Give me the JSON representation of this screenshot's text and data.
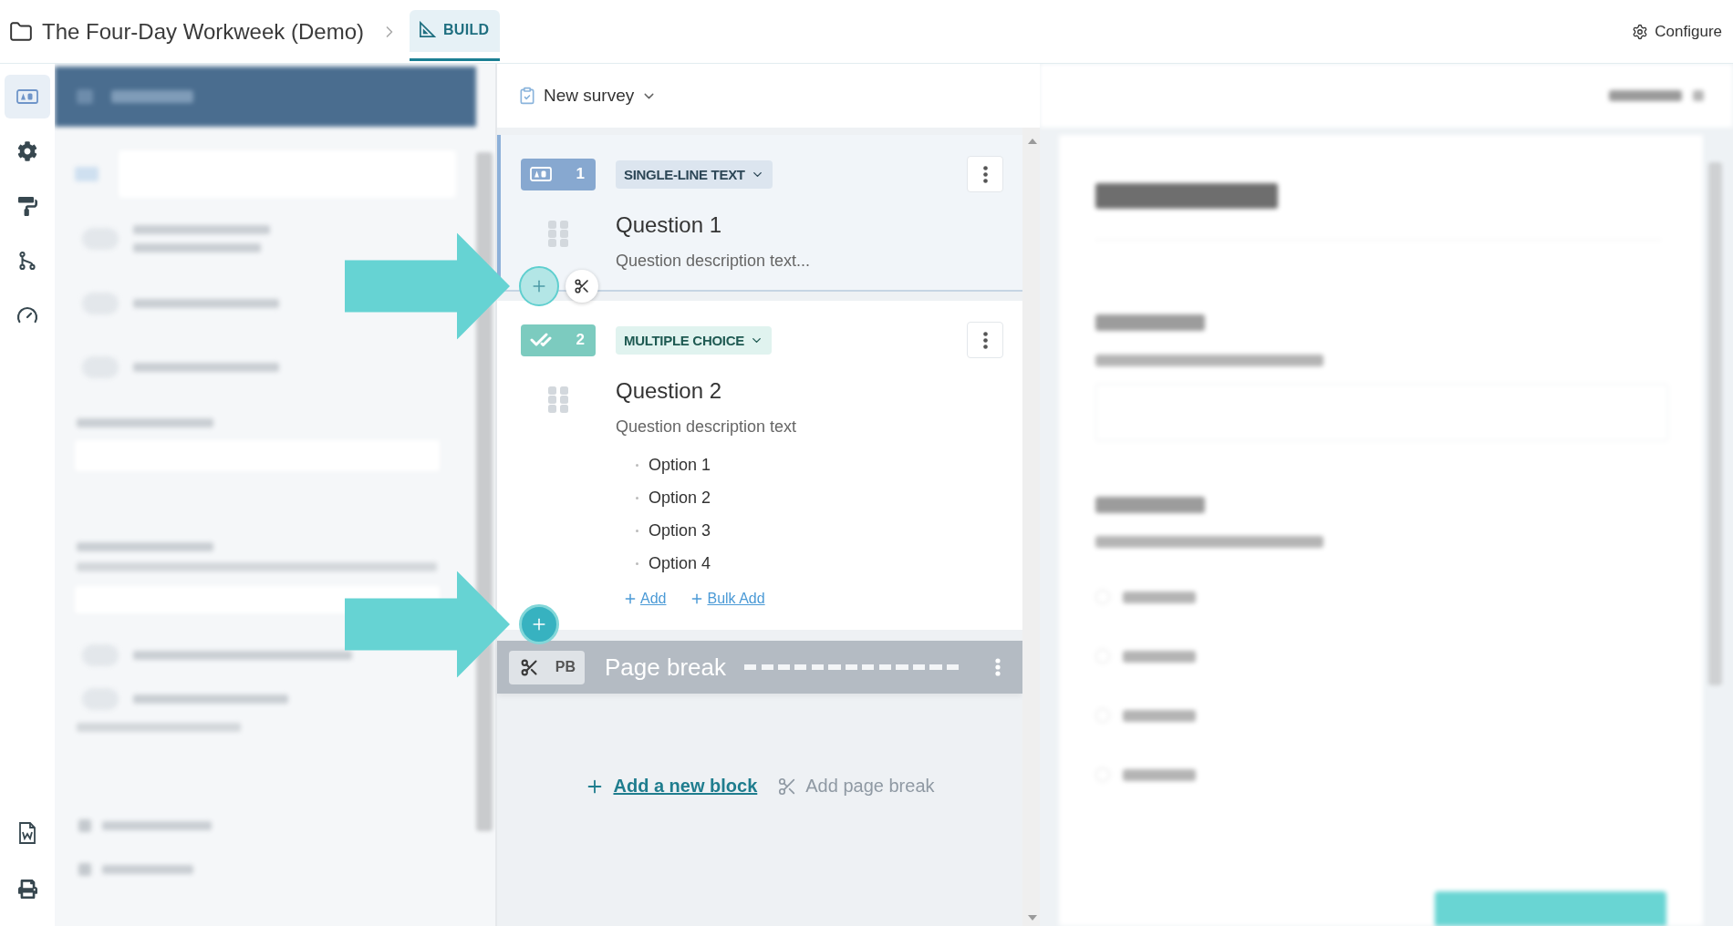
{
  "topbar": {
    "project_title": "The Four-Day Workweek (Demo)",
    "tabs": [
      {
        "label": "BUILD",
        "selected": true
      }
    ],
    "configure": "Configure"
  },
  "toolstrip": {
    "tools": [
      {
        "kind": "text",
        "selected": true
      },
      {
        "kind": "settings",
        "selected": false
      },
      {
        "kind": "style",
        "selected": false
      },
      {
        "kind": "logic",
        "selected": false
      },
      {
        "kind": "gauge",
        "selected": false
      }
    ],
    "bottom_tools": [
      {
        "kind": "document"
      },
      {
        "kind": "print"
      }
    ]
  },
  "editor": {
    "survey_name": "New survey",
    "questions": [
      {
        "kind": "text",
        "number": "1",
        "type_label": "SINGLE-LINE TEXT",
        "title": "Question 1",
        "description": "Question description text...",
        "selected": true,
        "insert": {
          "active": false,
          "cut": true,
          "callout": true
        }
      },
      {
        "kind": "choice",
        "number": "2",
        "type_label": "MULTIPLE CHOICE",
        "title": "Question 2",
        "description": "Question description text",
        "selected": false,
        "options": [
          "Option 1",
          "Option 2",
          "Option 3",
          "Option 4"
        ],
        "option_actions": [
          "Add",
          "Bulk Add"
        ],
        "insert": {
          "active": true,
          "cut": false,
          "callout": true
        }
      }
    ],
    "page_break": {
      "badge": "PB",
      "label": "Page break"
    },
    "footer_actions": [
      {
        "kind": "block",
        "label": "Add a new block",
        "disabled": false
      },
      {
        "kind": "break",
        "label": "Add page break",
        "disabled": true
      }
    ]
  }
}
